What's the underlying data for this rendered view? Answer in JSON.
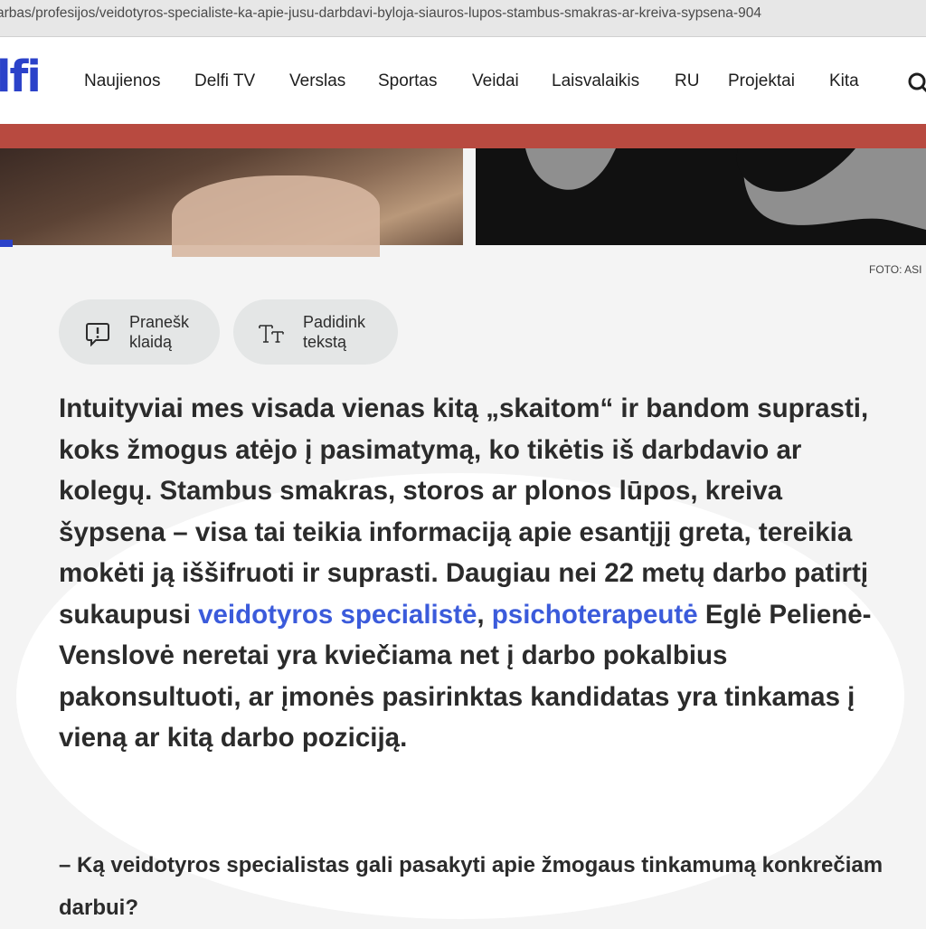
{
  "browser": {
    "url": "arbas/profesijos/veidotyros-specialiste-ka-apie-jusu-darbdavi-byloja-siauros-lupos-stambus-smakras-ar-kreiva-sypsena-904"
  },
  "site": {
    "logo": "lfi",
    "nav": [
      "Naujienos",
      "Delfi TV",
      "Verslas",
      "Sportas",
      "Veidai",
      "Laisvalaikis",
      "RU",
      "Projektai",
      "Kita"
    ],
    "brand_color": "#2b42c9"
  },
  "photo": {
    "caption": "FOTO: ASI"
  },
  "tools": {
    "report_line1": "Pranešk",
    "report_line2": "klaidą",
    "enlarge_line1": "Padidink",
    "enlarge_line2": "tekstą"
  },
  "article": {
    "text_before": "Intuityviai mes visada vienas kitą „skaitom“ ir bandom suprasti, koks žmogus atėjo į pasimatymą, ko tikėtis iš darbdavio ar kolegų. Stambus smakras, storos ar plonos lūpos, kreiva šypsena – visa tai teikia informaciją apie esantįjį greta, tereikia mokėti ją iššifruoti ir suprasti. Daugiau nei 22 metų darbo patirtį sukaupusi ",
    "link1": "veidotyros specialistė",
    "comma": ", ",
    "link2": "psichoterapeutė",
    "text_after": " Eglė Pelienė-Venslovė neretai yra kviečiama net į darbo pokalbius pakonsultuoti, ar įmonės pasirinktas kandidatas yra tinkamas į vieną ar kitą darbo poziciją.",
    "question": "– Ką veidotyros specialistas gali pasakyti apie žmogaus tinkamumą konkrečiam darbui?",
    "link_color": "#3b5bdb"
  }
}
